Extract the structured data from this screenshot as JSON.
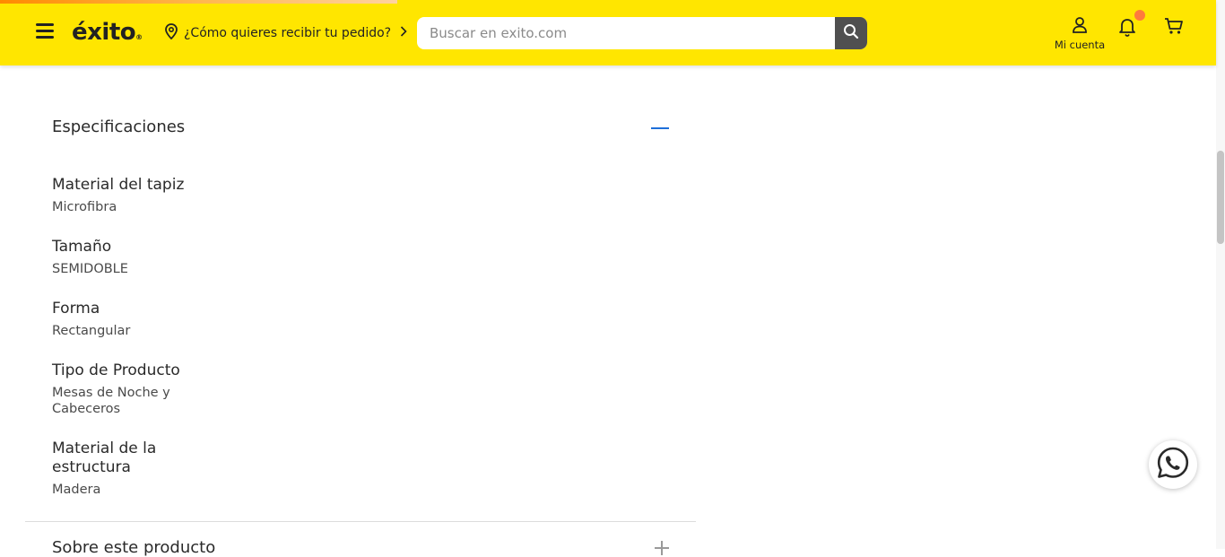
{
  "header": {
    "logo_text": "éxito",
    "logo_mark": "®",
    "delivery_prompt": "¿Cómo quieres recibir tu pedido?",
    "search_placeholder": "Buscar en exito.com",
    "account_label": "Mi cuenta",
    "accent_color": "#ffe600",
    "notification_badge_color": "#ff7a3d"
  },
  "specs": {
    "title": "Especificaciones",
    "items": [
      {
        "name": "Material del tapiz",
        "value": "Microfibra"
      },
      {
        "name": "Tamaño",
        "value": "SEMIDOBLE"
      },
      {
        "name": "Forma",
        "value": "Rectangular"
      },
      {
        "name": "Tipo de Producto",
        "value": "Mesas de Noche y Cabeceros"
      },
      {
        "name": "Material de la estructura",
        "value": "Madera"
      }
    ]
  },
  "next_section": {
    "title": "Sobre este producto"
  },
  "icons": {
    "menu": "hamburger-icon",
    "location": "location-pin-icon",
    "search": "search-icon",
    "account": "user-icon",
    "notifications": "bell-icon",
    "cart": "cart-icon",
    "whatsapp": "whatsapp-icon",
    "collapse": "minus-icon",
    "expand": "plus-icon"
  }
}
